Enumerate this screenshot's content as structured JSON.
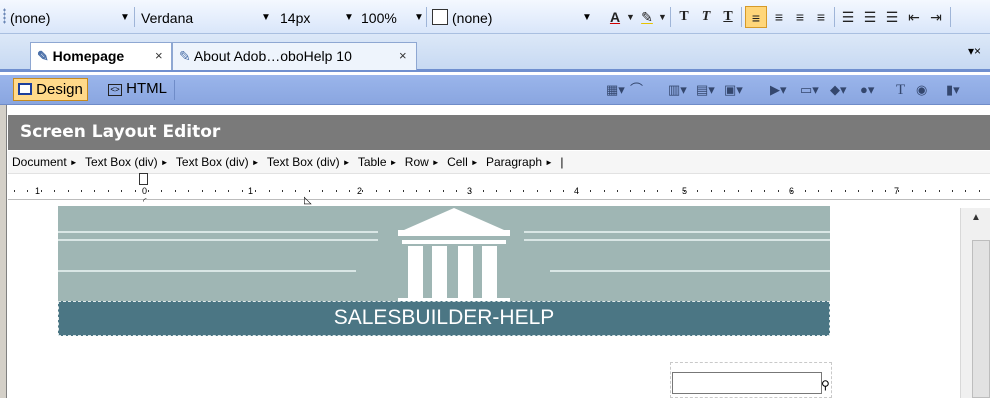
{
  "format_toolbar": {
    "style_value": "(none)",
    "font_value": "Verdana",
    "size_value": "14px",
    "zoom_value": "100%",
    "class_value": "(none)",
    "buttons": [
      "A",
      "✎",
      "T",
      "T",
      "T",
      "≡",
      "≡",
      "≡",
      "≡",
      "☰",
      "☰",
      "☰",
      "⇤",
      "⇥"
    ]
  },
  "tabs": [
    {
      "label": "Homepage",
      "close": "×",
      "active": true
    },
    {
      "label": "About Adob…oboHelp 10",
      "close": "×",
      "active": false
    }
  ],
  "tab_overflow": "▾×",
  "mode_bar": {
    "design_label": "Design",
    "html_label": "HTML"
  },
  "editor": {
    "title": "Screen Layout Editor",
    "breadcrumb": [
      "Document",
      "Text Box (div)",
      "Text Box (div)",
      "Text Box (div)",
      "Table",
      "Row",
      "Cell",
      "Paragraph"
    ],
    "breadcrumb_sep": "►",
    "breadcrumb_end": "|"
  },
  "ruler_numbers": [
    "1",
    "0",
    "1",
    "2",
    "3",
    "4",
    "5",
    "6",
    "7"
  ],
  "banner": {
    "text": "SALESBUILDER-HELP"
  },
  "colors": {
    "banner_bg": "#9fb6b4",
    "banner_band": "#4b7684",
    "header_gray": "#7a7a7a",
    "mode_bar_blue": "#9ab5eb"
  }
}
